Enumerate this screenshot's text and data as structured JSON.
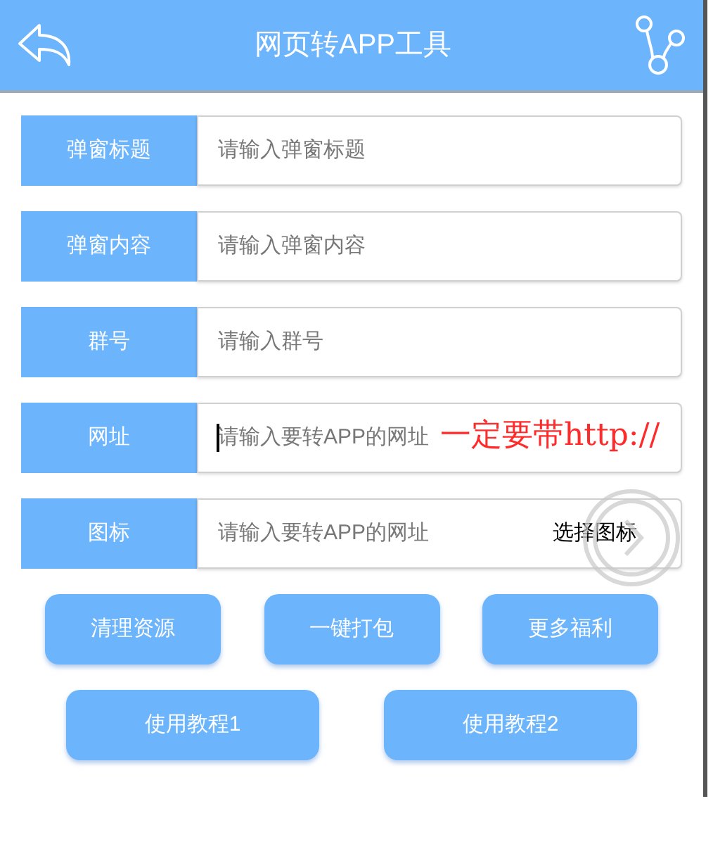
{
  "header": {
    "title": "网页转APP工具"
  },
  "fields": [
    {
      "label": "弹窗标题",
      "placeholder": "请输入弹窗标题",
      "focused": false
    },
    {
      "label": "弹窗内容",
      "placeholder": "请输入弹窗内容",
      "focused": false
    },
    {
      "label": "群号",
      "placeholder": "请输入群号",
      "focused": false
    },
    {
      "label": "网址",
      "placeholder": "请输入要转APP的网址",
      "focused": true,
      "annotation": "一定要带http://"
    },
    {
      "label": "图标",
      "placeholder": "请输入要转APP的网址",
      "focused": false,
      "action": "选择图标"
    }
  ],
  "button_rows": [
    [
      "清理资源",
      "一键打包",
      "更多福利"
    ],
    [
      "使用教程1",
      "使用教程2"
    ]
  ]
}
